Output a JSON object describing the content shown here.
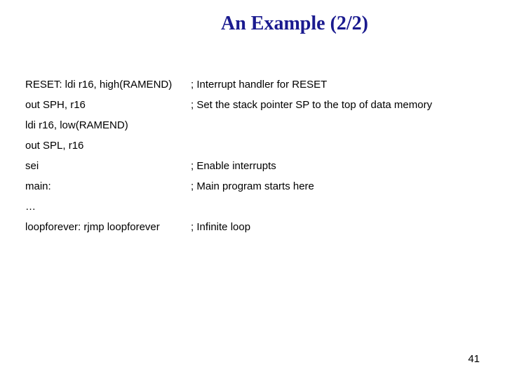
{
  "title": "An Example (2/2)",
  "lines": [
    {
      "code": "RESET: ldi r16, high(RAMEND)",
      "comment": "; Interrupt handler for RESET"
    },
    {
      "code": "out SPH, r16",
      "comment": "; Set the stack pointer SP to the top of data memory"
    },
    {
      "code": "ldi r16, low(RAMEND)",
      "comment": ""
    },
    {
      "code": "out SPL, r16",
      "comment": ""
    },
    {
      "code": "sei",
      "comment": "; Enable interrupts"
    },
    {
      "code": "main:",
      "comment": "; Main program starts here"
    },
    {
      "code": "…",
      "comment": ""
    },
    {
      "code": "loopforever: rjmp loopforever",
      "comment": "; Infinite loop"
    }
  ],
  "page_number": "41"
}
